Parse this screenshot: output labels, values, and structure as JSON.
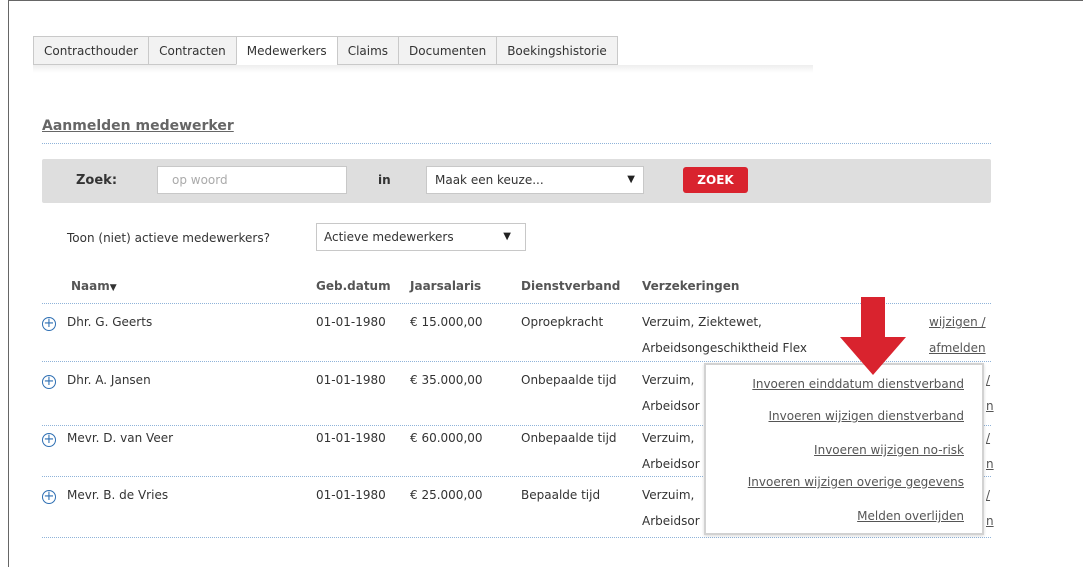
{
  "tabs": [
    {
      "label": "Contracthouder"
    },
    {
      "label": "Contracten"
    },
    {
      "label": "Medewerkers"
    },
    {
      "label": "Claims"
    },
    {
      "label": "Documenten"
    },
    {
      "label": "Boekingshistorie"
    }
  ],
  "active_tab": "Medewerkers",
  "page_title": "Aanmelden medewerker",
  "search": {
    "label": "Zoek:",
    "placeholder": "op woord",
    "in_label": "in",
    "select_value": "Maak een keuze...",
    "button_label": "ZOEK"
  },
  "filter": {
    "label": "Toon (niet) actieve medewerkers?",
    "select_value": "Actieve medewerkers"
  },
  "table": {
    "headers": [
      "Naam",
      "Geb.datum",
      "Jaarsalaris",
      "Dienstverband",
      "Verzekeringen"
    ],
    "rows": [
      {
        "naam": "Dhr. G. Geerts",
        "geb": "01-01-1980",
        "salaris": "€ 15.000,00",
        "dienstverband": "Oproepkracht",
        "verz1": "Verzuim, Ziektewet,",
        "verz2": "Arbeidsongeschiktheid Flex",
        "action1": "wijzigen /",
        "action2": "afmelden"
      },
      {
        "naam": "Dhr. A. Jansen",
        "geb": "01-01-1980",
        "salaris": "€ 35.000,00",
        "dienstverband": "Onbepaalde tijd",
        "verz1": "Verzuim,",
        "verz2": "Arbeidsor",
        "action1": "/",
        "action2": "n"
      },
      {
        "naam": "Mevr. D. van Veer",
        "geb": "01-01-1980",
        "salaris": "€ 60.000,00",
        "dienstverband": "Onbepaalde tijd",
        "verz1": "Verzuim,",
        "verz2": "Arbeidsor",
        "action1": "/",
        "action2": "n"
      },
      {
        "naam": "Mevr. B. de Vries",
        "geb": "01-01-1980",
        "salaris": "€ 25.000,00",
        "dienstverband": "Bepaalde tijd",
        "verz1": "Verzuim,",
        "verz2": "Arbeidsor",
        "action1": "/",
        "action2": "n"
      }
    ]
  },
  "popup_menu": {
    "items": [
      {
        "label": "Invoeren einddatum dienstverband"
      },
      {
        "label": "Invoeren wijzigen dienstverband"
      },
      {
        "label": "Invoeren wijzigen no-risk"
      },
      {
        "label": "Invoeren wijzigen overige gegevens"
      },
      {
        "label": "Melden overlijden"
      }
    ]
  },
  "colors": {
    "accent_red": "#d9232e",
    "link_blue": "#2e6fb3",
    "bar_gray": "#dedede"
  },
  "icons": {
    "expand": "plus-circle-icon",
    "pointer": "red-down-arrow-icon",
    "sort": "sort-down-icon",
    "dropdown": "caret-down-icon"
  }
}
